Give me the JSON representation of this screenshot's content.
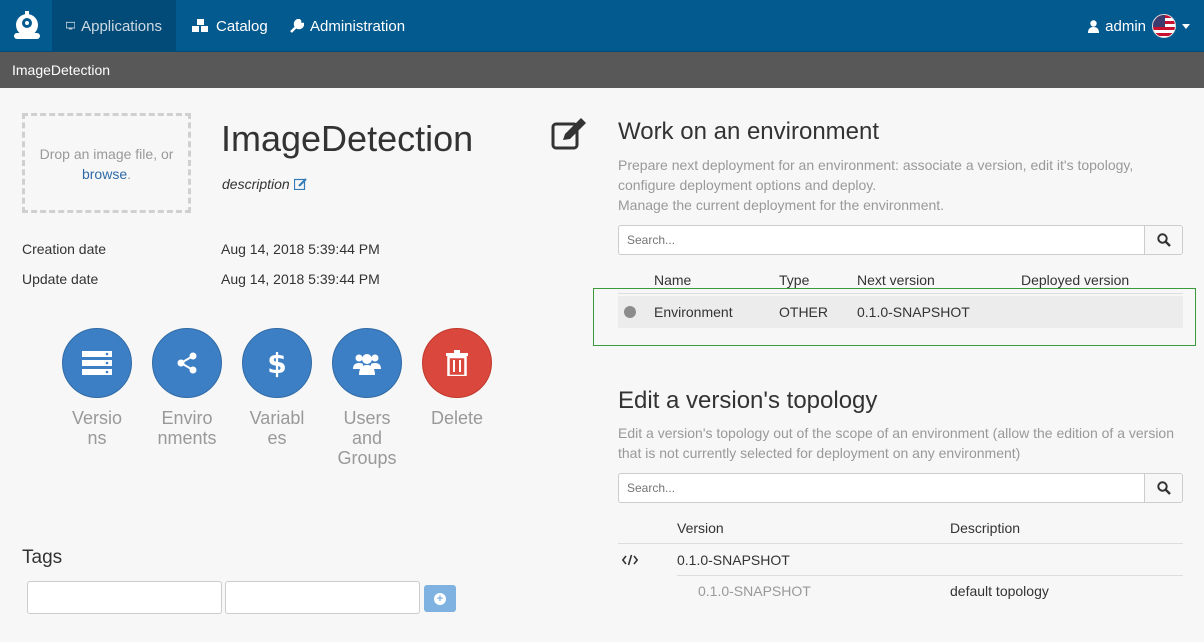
{
  "nav": {
    "applications": "Applications",
    "catalog": "Catalog",
    "administration": "Administration",
    "user": "admin"
  },
  "breadcrumb": "ImageDetection",
  "app": {
    "drop_text": "Drop an image file, or",
    "browse": "browse",
    "browse_suffix": ".",
    "title": "ImageDetection",
    "description": "description",
    "creation_label": "Creation date",
    "creation_value": "Aug 14, 2018 5:39:44 PM",
    "update_label": "Update date",
    "update_value": "Aug 14, 2018 5:39:44 PM"
  },
  "actions": [
    {
      "label": "Versions",
      "icon": "server-icon"
    },
    {
      "label": "Environments",
      "icon": "share-icon"
    },
    {
      "label": "Variables",
      "icon": "dollar-icon"
    },
    {
      "label": "Users and Groups",
      "icon": "users-icon"
    },
    {
      "label": "Delete",
      "icon": "trash-icon"
    }
  ],
  "tags": {
    "title": "Tags"
  },
  "environment": {
    "title": "Work on an environment",
    "desc1": "Prepare next deployment for an environment: associate a version, edit it's topology,",
    "desc2": "configure deployment options and deploy.",
    "desc3": "Manage the current deployment for the environment.",
    "search_placeholder": "Search...",
    "columns": [
      "Name",
      "Type",
      "Next version",
      "Deployed version"
    ],
    "rows": [
      {
        "name": "Environment",
        "type": "OTHER",
        "next": "0.1.0-SNAPSHOT",
        "deployed": ""
      }
    ]
  },
  "topology": {
    "title": "Edit a version's topology",
    "desc1": "Edit a version's topology out of the scope of an environment (allow the edition of a version",
    "desc2": "that is not currently selected for deployment on any environment)",
    "search_placeholder": "Search...",
    "columns": [
      "Version",
      "Description"
    ],
    "version": "0.1.0-SNAPSHOT",
    "sub_version": "0.1.0-SNAPSHOT",
    "sub_description": "default topology"
  },
  "colors": {
    "nav": "#035a8e",
    "crumb": "#585858",
    "action_blue": "#3d7fc4",
    "action_red": "#d9473d",
    "highlight": "#3c9a3c"
  }
}
